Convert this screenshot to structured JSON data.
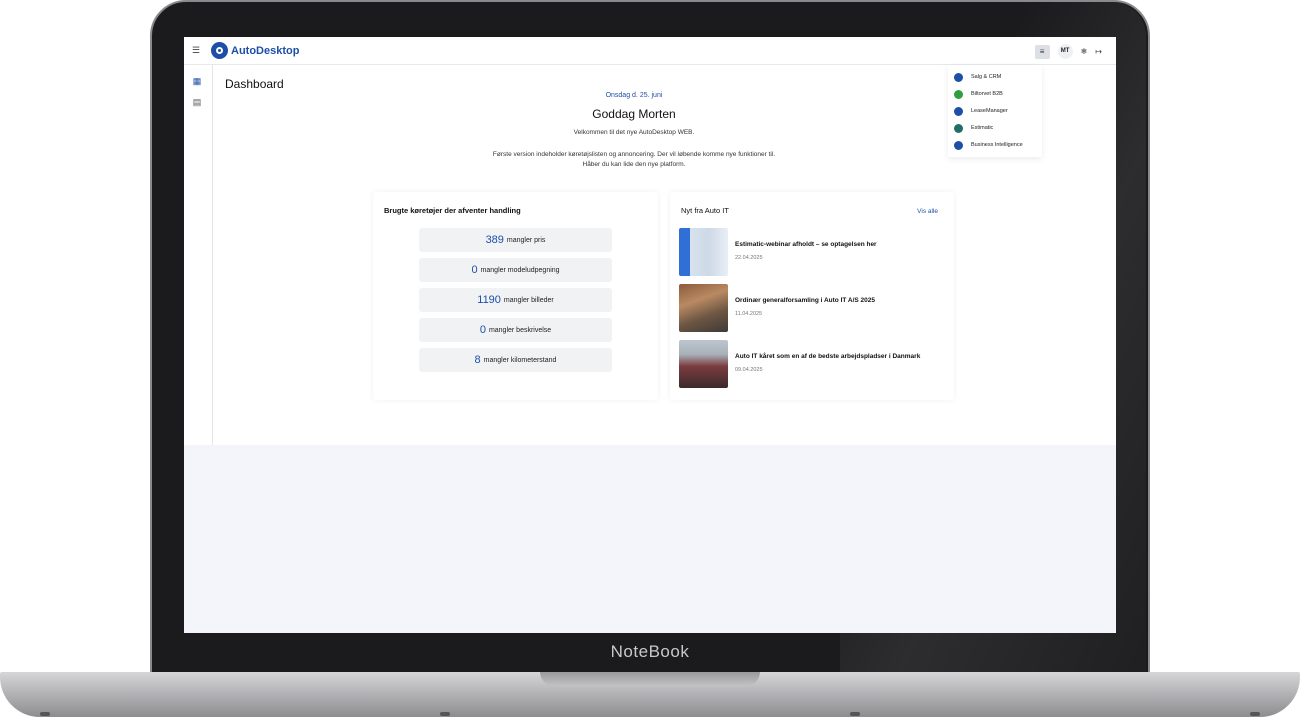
{
  "device": {
    "brand": "NoteBook"
  },
  "app": {
    "name": "AutoDesktop",
    "brand_color": "#1d4fa8"
  },
  "header": {
    "menu_icon": "hamburger-icon",
    "apps_icon": "apps-grid-icon",
    "avatar_initials": "MT",
    "settings_icon": "gear-icon",
    "logout_icon": "logout-icon"
  },
  "sidebar": {
    "items": [
      {
        "icon": "dashboard-icon",
        "active": true
      },
      {
        "icon": "car-icon",
        "active": false
      }
    ]
  },
  "page": {
    "title": "Dashboard",
    "date": "Onsdag d. 25. juni",
    "greeting": "Goddag Morten",
    "welcome": "Velkommen til det nye AutoDesktop WEB.",
    "info_line1": "Første version indeholder køretøjslisten og annoncering. Der vil løbende komme nye funktioner til.",
    "info_line2": "Håber du kan lide den nye platform."
  },
  "vehicles_card": {
    "title": "Brugte køretøjer der afventer handling",
    "stats": [
      {
        "value": "389",
        "label": "mangler pris"
      },
      {
        "value": "0",
        "label": "mangler modeludpegning"
      },
      {
        "value": "1190",
        "label": "mangler billeder"
      },
      {
        "value": "0",
        "label": "mangler beskrivelse"
      },
      {
        "value": "8",
        "label": "mangler kilometerstand"
      }
    ]
  },
  "news_card": {
    "title": "Nyt fra Auto IT",
    "see_all": "Vis alle",
    "items": [
      {
        "title": "Estimatic-webinar afholdt – se optagelsen her",
        "date": "22.04.2025"
      },
      {
        "title": "Ordinær generalforsamling i Auto IT A/S 2025",
        "date": "11.04.2025"
      },
      {
        "title": "Auto IT kåret som en af de bedste arbejdspladser i Danmark",
        "date": "09.04.2025"
      }
    ]
  },
  "apps_menu": {
    "items": [
      {
        "label": "Salg & CRM",
        "color": "#1d4fa8"
      },
      {
        "label": "Biltorvet B2B",
        "color": "#2e9e3e"
      },
      {
        "label": "LeaseManager",
        "color": "#1d4fa8"
      },
      {
        "label": "Estimatic",
        "color": "#1f6e6a"
      },
      {
        "label": "Business Intelligence",
        "color": "#1d4fa8"
      }
    ]
  }
}
